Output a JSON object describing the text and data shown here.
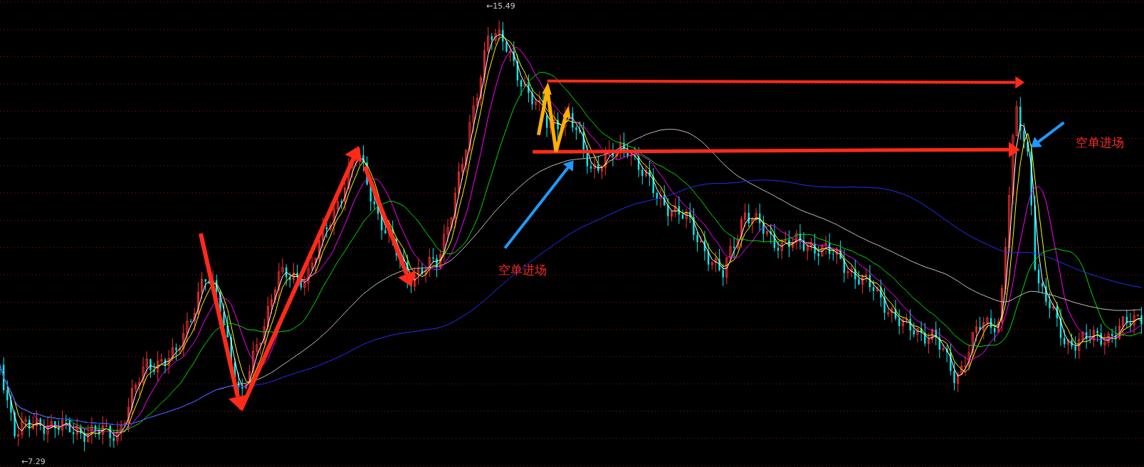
{
  "chart": {
    "high_label": "←15.49",
    "low_label": "←7.29"
  },
  "annotations": [
    {
      "text": "空单进场"
    },
    {
      "text": "空单进场"
    }
  ]
}
